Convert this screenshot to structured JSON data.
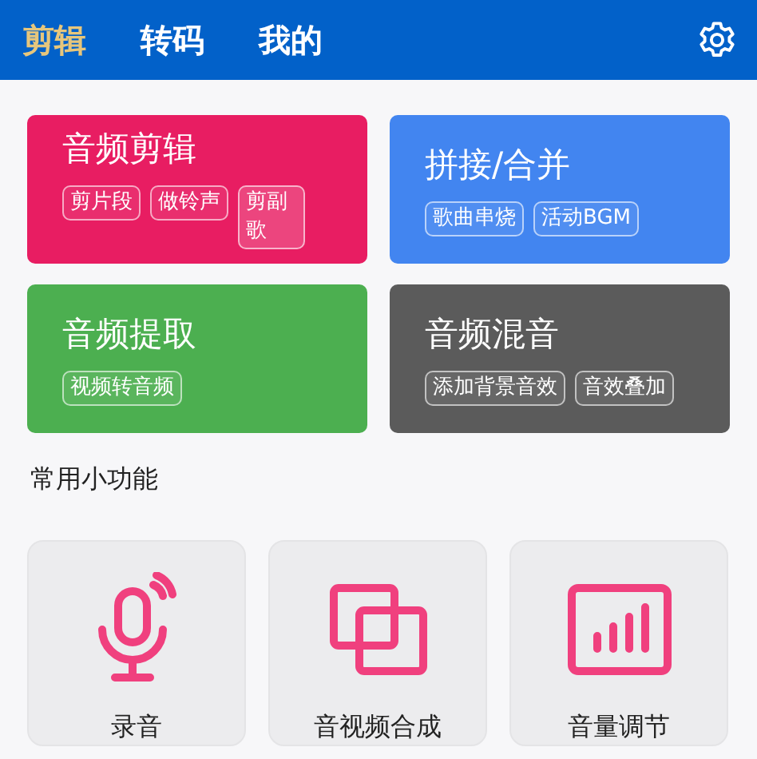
{
  "tabs": [
    {
      "label": "剪辑",
      "selected": true
    },
    {
      "label": "转码",
      "selected": false
    },
    {
      "label": "我的",
      "selected": false
    }
  ],
  "features": [
    {
      "title": "音频剪辑",
      "color": "#e81d62",
      "tags": [
        "剪片段",
        "做铃声",
        "剪副歌"
      ]
    },
    {
      "title": "拼接/合并",
      "color": "#4285f0",
      "tags": [
        "歌曲串烧",
        "活动BGM"
      ]
    },
    {
      "title": "音频提取",
      "color": "#4caf50",
      "tags": [
        "视频转音频"
      ]
    },
    {
      "title": "音频混音",
      "color": "#5b5b5b",
      "tags": [
        "添加背景音效",
        "音效叠加"
      ]
    }
  ],
  "section_title": "常用小功能",
  "tools": [
    {
      "kind": "microphone",
      "label": "录音"
    },
    {
      "kind": "squares",
      "label": "音视频合成"
    },
    {
      "kind": "bars",
      "label": "音量调节"
    }
  ]
}
